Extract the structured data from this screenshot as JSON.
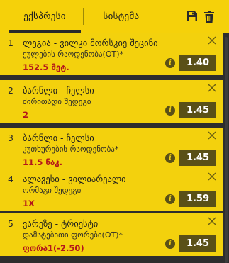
{
  "tabs": {
    "accumulator": "ექსპრესი",
    "system": "სისტემა"
  },
  "colors": {
    "header": "#f5d10a",
    "card": "#f3d10d",
    "odds_bg": "#5a5017",
    "selection_text": "#b3161b",
    "background": "#2d2d2d"
  },
  "icons": {
    "save": "save-icon",
    "delete": "trash-icon",
    "remove": "close-icon",
    "info": "info-icon"
  },
  "bets": [
    {
      "num": "1",
      "teams": "ლეგია - ვილკი მორსკიე შეცინი",
      "market": "ქულების რაოდენობა(OT)*",
      "selection": "152.5 მეტ.",
      "odds": "1.40"
    },
    {
      "num": "2",
      "teams": "ბარნლი - ჩელსი",
      "market": "ძირითადი შედეგი",
      "selection": "2",
      "odds": "1.45"
    },
    {
      "num": "3",
      "teams": "ბარნლი - ჩელსი",
      "market": "კუთხურების რაოდენობა*",
      "selection": "11.5 ნაკ.",
      "odds": "1.45"
    },
    {
      "num": "4",
      "teams": "ალავესი - ვილიარეალი",
      "market": "ორმაგი შედეგი",
      "selection": "1X",
      "odds": "1.59"
    },
    {
      "num": "5",
      "teams": "ვარეზე - ტრიესტი",
      "market": "დამატებითი ფორები(OT)*",
      "selection": "ფორა1(-2.50)",
      "odds": "1.45"
    }
  ]
}
